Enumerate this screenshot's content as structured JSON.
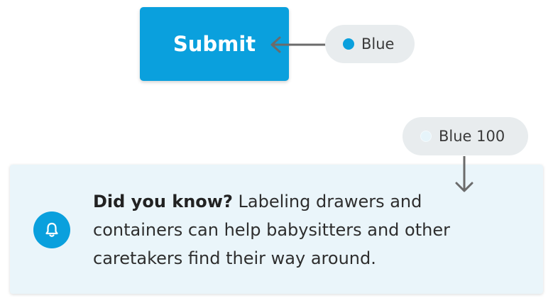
{
  "submit_button": {
    "label": "Submit"
  },
  "color_labels": [
    {
      "name": "Blue",
      "hex": "#0aa0dd"
    },
    {
      "name": "Blue 100",
      "hex": "#e6f4fa"
    }
  ],
  "info_card": {
    "icon": "bell-icon",
    "heading": "Did you know?",
    "body": " Labeling drawers and containers can help babysitters and other caretakers find their way around."
  },
  "colors": {
    "primary": "#0aa0dd",
    "card_background": "#eaf5fa",
    "pill_background": "#e8ecee",
    "arrow": "#6b6b6b"
  }
}
